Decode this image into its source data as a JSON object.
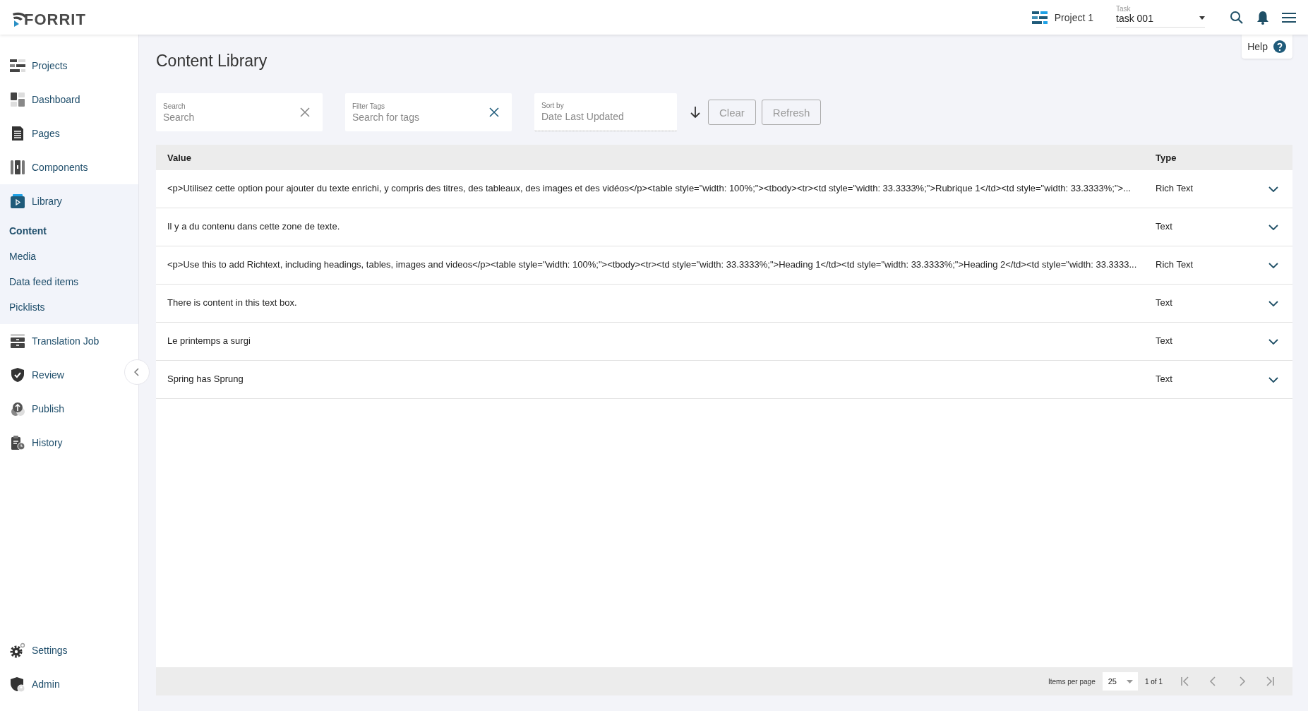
{
  "header": {
    "logo": "FORRIT",
    "project": "Project 1",
    "task": {
      "label": "Task",
      "value": "task 001"
    }
  },
  "sidebar": {
    "items": [
      {
        "label": "Projects"
      },
      {
        "label": "Dashboard"
      },
      {
        "label": "Pages"
      },
      {
        "label": "Components"
      },
      {
        "label": "Library",
        "expanded": true,
        "children": [
          {
            "label": "Content",
            "selected": true
          },
          {
            "label": "Media",
            "selected": false
          },
          {
            "label": "Data feed items",
            "selected": false
          },
          {
            "label": "Picklists",
            "selected": false
          }
        ]
      },
      {
        "label": "Translation Job"
      },
      {
        "label": "Review"
      },
      {
        "label": "Publish"
      },
      {
        "label": "History"
      }
    ],
    "bottom_items": [
      {
        "label": "Settings"
      },
      {
        "label": "Admin"
      }
    ]
  },
  "help": "Help",
  "page_title": "Content Library",
  "filters": [
    {
      "kind": "search",
      "label": "Search",
      "placeholder": "Search"
    },
    {
      "kind": "tags",
      "label": "Filter Tags",
      "placeholder": "Search for tags"
    },
    {
      "kind": "sort",
      "label": "Sort by",
      "placeholder": "Date Last Updated"
    }
  ],
  "buttons": [
    "Clear",
    "Refresh"
  ],
  "table": {
    "columns": [
      "Value",
      "Type"
    ],
    "rows": [
      {
        "value": "<p>Utilisez cette option pour ajouter du texte enrichi, y compris des titres, des tableaux, des images et des vidéos</p><table style=\"width: 100%;\"><tbody><tr><td style=\"width: 33.3333%;\">Rubrique 1</td><td style=\"width: 33.3333%;\">...",
        "type": "Rich Text",
        "expanded": false
      },
      {
        "value": "Il y a du contenu dans cette zone de texte.",
        "type": "Text",
        "expanded": false
      },
      {
        "value": "<p>Use this to add Richtext, including headings, tables, images and videos</p><table style=\"width: 100%;\"><tbody><tr><td style=\"width: 33.3333%;\">Heading 1</td><td style=\"width: 33.3333%;\">Heading 2</td><td style=\"width: 33.3333...",
        "type": "Rich Text",
        "expanded": false
      },
      {
        "value": "There is content in this text box.",
        "type": "Text",
        "expanded": false
      },
      {
        "value": "Le printemps a surgi",
        "type": "Text",
        "expanded": false
      },
      {
        "value": "Spring has Sprung",
        "type": "Text",
        "expanded": false
      }
    ]
  },
  "pagination": {
    "label": "Items per page",
    "page_size": "25",
    "range": "1 of 1"
  }
}
